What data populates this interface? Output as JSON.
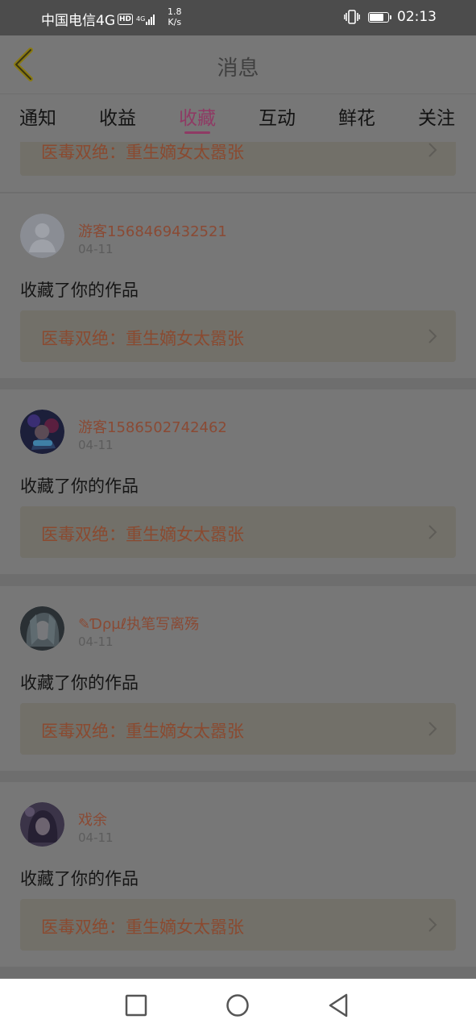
{
  "status_bar": {
    "carrier": "中国电信4G",
    "hd": "HD",
    "signal_type": "4G",
    "speed_value": "1.8",
    "speed_unit": "K/s",
    "time": "02:13",
    "battery_level": 0.8,
    "icons": [
      "vibrate-icon",
      "battery-icon",
      "signal-icon"
    ]
  },
  "header": {
    "title": "消息",
    "back_icon": "chevron-left-icon"
  },
  "tabs": [
    {
      "label": "通知",
      "active": false
    },
    {
      "label": "收益",
      "active": false
    },
    {
      "label": "收藏",
      "active": true
    },
    {
      "label": "互动",
      "active": false
    },
    {
      "label": "鲜花",
      "active": false
    },
    {
      "label": "关注",
      "active": false
    }
  ],
  "feed": {
    "partial_top_card": {
      "work_title": "医毒双绝：重生嫡女太嚣张"
    },
    "items": [
      {
        "user": "游客1568469432521",
        "date": "04-11",
        "action": "收藏了你的作品",
        "work_title": "医毒双绝：重生嫡女太嚣张",
        "avatar": "default-avatar-icon"
      },
      {
        "user": "游客1586502742462",
        "date": "04-11",
        "action": "收藏了你的作品",
        "work_title": "医毒双绝：重生嫡女太嚣张",
        "avatar": "anime-avatar"
      },
      {
        "user": "✎Ɗρμℓ执笔写离殇",
        "date": "04-11",
        "action": "收藏了你的作品",
        "work_title": "医毒双绝：重生嫡女太嚣张",
        "avatar": "anime-girl-avatar"
      },
      {
        "user": "戏余",
        "date": "04-11",
        "action": "收藏了你的作品",
        "work_title": "医毒双绝：重生嫡女太嚣张",
        "avatar": "anime-portrait-avatar"
      }
    ]
  },
  "nav_bar": {
    "buttons": [
      "recent-apps-icon",
      "home-icon",
      "back-triangle-icon"
    ]
  },
  "colors": {
    "accent": "#e1459c",
    "username": "#f1826a",
    "overlay": "#777777"
  }
}
